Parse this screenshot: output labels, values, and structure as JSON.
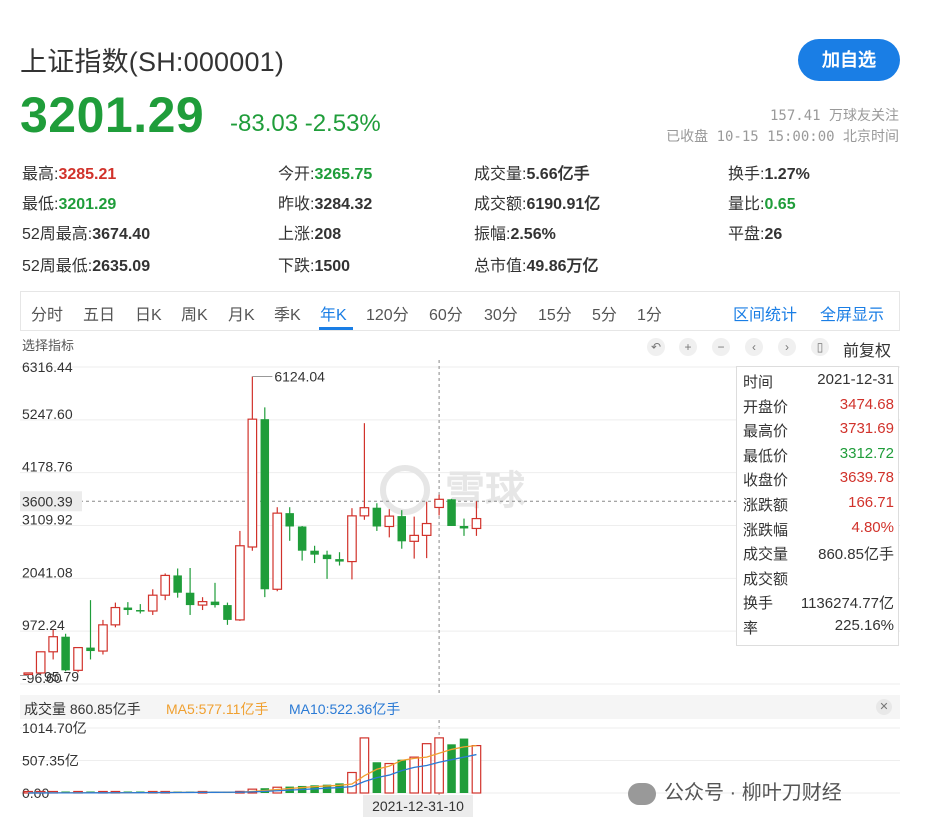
{
  "header": {
    "title": "上证指数(SH:000001)",
    "follow_button": "加自选",
    "price": "3201.29",
    "change": "-83.03 -2.53%",
    "followers": "157.41 万球友关注",
    "status": "已收盘 10-15 15:00:00 北京时间"
  },
  "stats": [
    {
      "label": "最高:",
      "value": "3285.21",
      "color": "red"
    },
    {
      "label": "今开:",
      "value": "3265.75",
      "color": "green"
    },
    {
      "label": "成交量:",
      "value": "5.66亿手",
      "color": "plain"
    },
    {
      "label": "换手:",
      "value": "1.27%",
      "color": "plain"
    },
    {
      "label": "最低:",
      "value": "3201.29",
      "color": "green"
    },
    {
      "label": "昨收:",
      "value": "3284.32",
      "color": "plain"
    },
    {
      "label": "成交额:",
      "value": "6190.91亿",
      "color": "plain"
    },
    {
      "label": "量比:",
      "value": "0.65",
      "color": "green"
    },
    {
      "label": "52周最高:",
      "value": "3674.40",
      "color": "plain"
    },
    {
      "label": "上涨:",
      "value": "208",
      "color": "plain"
    },
    {
      "label": "振幅:",
      "value": "2.56%",
      "color": "plain"
    },
    {
      "label": "平盘:",
      "value": "26",
      "color": "plain"
    },
    {
      "label": "52周最低:",
      "value": "2635.09",
      "color": "plain"
    },
    {
      "label": "下跌:",
      "value": "1500",
      "color": "plain"
    },
    {
      "label": "总市值:",
      "value": "49.86万亿",
      "color": "plain"
    }
  ],
  "tabs": [
    "分时",
    "五日",
    "日K",
    "周K",
    "月K",
    "季K",
    "年K",
    "120分",
    "60分",
    "30分",
    "15分",
    "5分",
    "1分"
  ],
  "active_tab": "年K",
  "tab_links": [
    "区间统计",
    "全屏显示"
  ],
  "chart_toolbar": {
    "indicator_label": "选择指标",
    "adjust_label": "前复权",
    "icons": [
      "undo-icon",
      "zoom-in-icon",
      "zoom-out-icon",
      "scroll-left-icon",
      "scroll-right-icon",
      "candle-type-icon"
    ]
  },
  "chart_data": {
    "type": "candlestick",
    "y_ticks": [
      "6316.44",
      "5247.60",
      "4178.76",
      "3109.92",
      "2041.08",
      "972.24",
      "-96.60"
    ],
    "y_range": [
      -96.6,
      6316.44
    ],
    "crosshair_value": "3600.39",
    "max_label": "6124.04",
    "min_label": "95.79",
    "candles": [
      {
        "o": 100,
        "h": 128,
        "l": 95.79,
        "c": 127
      },
      {
        "o": 127,
        "h": 560,
        "l": 105,
        "c": 555
      },
      {
        "o": 555,
        "h": 1000,
        "l": 400,
        "c": 860
      },
      {
        "o": 860,
        "h": 920,
        "l": 160,
        "c": 180
      },
      {
        "o": 180,
        "h": 650,
        "l": 140,
        "c": 640
      },
      {
        "o": 640,
        "h": 1600,
        "l": 400,
        "c": 570
      },
      {
        "o": 570,
        "h": 1200,
        "l": 500,
        "c": 1100
      },
      {
        "o": 1100,
        "h": 1550,
        "l": 1050,
        "c": 1450
      },
      {
        "o": 1450,
        "h": 1560,
        "l": 1300,
        "c": 1400
      },
      {
        "o": 1400,
        "h": 1520,
        "l": 1330,
        "c": 1380
      },
      {
        "o": 1380,
        "h": 1820,
        "l": 1300,
        "c": 1700
      },
      {
        "o": 1700,
        "h": 2140,
        "l": 1600,
        "c": 2100
      },
      {
        "o": 2100,
        "h": 2240,
        "l": 1650,
        "c": 1750
      },
      {
        "o": 1750,
        "h": 2250,
        "l": 1300,
        "c": 1500
      },
      {
        "o": 1500,
        "h": 1660,
        "l": 1400,
        "c": 1570
      },
      {
        "o": 1570,
        "h": 1950,
        "l": 1450,
        "c": 1500
      },
      {
        "o": 1500,
        "h": 1550,
        "l": 1100,
        "c": 1200
      },
      {
        "o": 1200,
        "h": 3000,
        "l": 1180,
        "c": 2700
      },
      {
        "o": 2675,
        "h": 6124.04,
        "l": 2600,
        "c": 5261
      },
      {
        "o": 5261,
        "h": 5500,
        "l": 1660,
        "c": 1820
      },
      {
        "o": 1820,
        "h": 3480,
        "l": 1780,
        "c": 3360
      },
      {
        "o": 3360,
        "h": 3480,
        "l": 2800,
        "c": 3090
      },
      {
        "o": 3090,
        "h": 3100,
        "l": 2400,
        "c": 2600
      },
      {
        "o": 2600,
        "h": 2700,
        "l": 2350,
        "c": 2520
      },
      {
        "o": 2520,
        "h": 2600,
        "l": 2030,
        "c": 2430
      },
      {
        "o": 2430,
        "h": 2570,
        "l": 2300,
        "c": 2380
      },
      {
        "o": 2380,
        "h": 3460,
        "l": 2020,
        "c": 3305
      },
      {
        "o": 3305,
        "h": 5180,
        "l": 3225,
        "c": 3470
      },
      {
        "o": 3470,
        "h": 3560,
        "l": 3000,
        "c": 3090
      },
      {
        "o": 3090,
        "h": 3440,
        "l": 2870,
        "c": 3300
      },
      {
        "o": 3300,
        "h": 3420,
        "l": 2640,
        "c": 2790
      },
      {
        "o": 2790,
        "h": 3290,
        "l": 2440,
        "c": 2910
      },
      {
        "o": 2910,
        "h": 3590,
        "l": 2450,
        "c": 3150
      },
      {
        "o": 3474.68,
        "h": 3731.69,
        "l": 3312.72,
        "c": 3639.78
      },
      {
        "o": 3640,
        "h": 3650,
        "l": 3100,
        "c": 3100
      },
      {
        "o": 3100,
        "h": 3250,
        "l": 2900,
        "c": 3050
      },
      {
        "o": 3050,
        "h": 3600,
        "l": 2900,
        "c": 3250
      }
    ],
    "volumes": [
      1,
      2,
      2,
      3,
      3,
      4,
      5,
      6,
      8,
      10,
      12,
      14,
      15,
      16,
      18,
      20,
      22,
      25,
      60,
      75,
      90,
      100,
      110,
      120,
      130,
      150,
      320,
      860,
      480,
      460,
      520,
      560,
      770,
      860.85,
      760,
      850,
      740
    ],
    "ma5": [
      1,
      2,
      2,
      2,
      3,
      3,
      4,
      4,
      5,
      6,
      7,
      8,
      9,
      10,
      11,
      12,
      13,
      14,
      25,
      38,
      55,
      70,
      85,
      100,
      110,
      120,
      140,
      270,
      370,
      420,
      510,
      540,
      560,
      620,
      680,
      720,
      740
    ],
    "ma10": [
      1,
      1,
      2,
      2,
      2,
      3,
      3,
      4,
      4,
      5,
      6,
      7,
      8,
      9,
      10,
      11,
      12,
      13,
      18,
      25,
      35,
      45,
      55,
      65,
      75,
      85,
      100,
      180,
      240,
      280,
      350,
      400,
      430,
      480,
      520,
      560,
      600
    ],
    "volume_ticks": [
      "1014.70亿",
      "507.35亿",
      "0.00"
    ],
    "volume_range": [
      0,
      1014.7
    ],
    "highlighted_index": 33,
    "highlighted_date": "2021-12-31-10"
  },
  "tooltip": [
    {
      "label": "时间",
      "value": "2021-12-31",
      "color": "#333333"
    },
    {
      "label": "开盘价",
      "value": "3474.68",
      "color": "#d1322b"
    },
    {
      "label": "最高价",
      "value": "3731.69",
      "color": "#d1322b"
    },
    {
      "label": "最低价",
      "value": "3312.72",
      "color": "#1f9d3a"
    },
    {
      "label": "收盘价",
      "value": "3639.78",
      "color": "#d1322b"
    },
    {
      "label": "涨跌额",
      "value": "166.71",
      "color": "#d1322b"
    },
    {
      "label": "涨跌幅",
      "value": "4.80%",
      "color": "#d1322b"
    },
    {
      "label": "成交量",
      "value": "860.85亿手",
      "color": "#333333"
    },
    {
      "label": "成交额",
      "value": "",
      "color": "#333333"
    },
    {
      "label": "换手",
      "value": "1136274.77亿",
      "color": "#333333"
    },
    {
      "label": "率",
      "value": "225.16%",
      "color": "#333333"
    }
  ],
  "volume_header": {
    "volume": "成交量 860.85亿手",
    "ma5": "MA5:577.11亿手",
    "ma10": "MA10:522.36亿手"
  },
  "chart_watermark": "雪球",
  "watermark": "公众号 · 柳叶刀财经",
  "colors": {
    "up": "#d1322b",
    "down": "#1f9d3a",
    "accent": "#1a7ee5",
    "ma5": "#f0a030",
    "ma10": "#2a7ad5"
  }
}
